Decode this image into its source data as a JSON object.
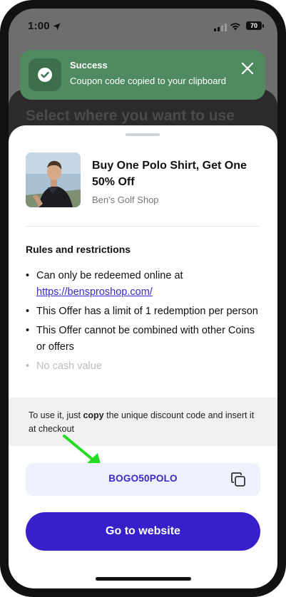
{
  "status_bar": {
    "time": "1:00",
    "battery": "70",
    "icons": [
      "location-arrow-icon",
      "signal-icon",
      "wifi-icon",
      "battery-icon"
    ]
  },
  "background_page": {
    "title": "Select where you want to use"
  },
  "toast": {
    "title": "Success",
    "message": "Coupon code copied to your clipboard",
    "icon": "check-circle-icon",
    "close_icon": "close-icon",
    "color": "#4f8a60"
  },
  "offer": {
    "title": "Buy One Polo Shirt, Get One 50% Off",
    "shop": "Ben's Golf Shop",
    "image": "product-photo"
  },
  "rules": {
    "heading": "Rules and restrictions",
    "items": [
      {
        "text": "Can only be redeemed online at ",
        "link": "https://bensproshop.com/"
      },
      {
        "text": "This Offer has a limit of 1 redemption per person"
      },
      {
        "text": "This Offer cannot be combined with other Coins or offers"
      },
      {
        "text": "No cash value"
      }
    ]
  },
  "instructions": {
    "before": "To use it, just ",
    "bold": "copy",
    "after": " the unique discount code and insert it at checkout"
  },
  "coupon": {
    "code": "BOGO50POLO",
    "copy_icon": "copy-icon"
  },
  "cta": {
    "label": "Go to website",
    "color": "#3720c9"
  },
  "annotation": {
    "arrow_color": "#22dd22"
  }
}
